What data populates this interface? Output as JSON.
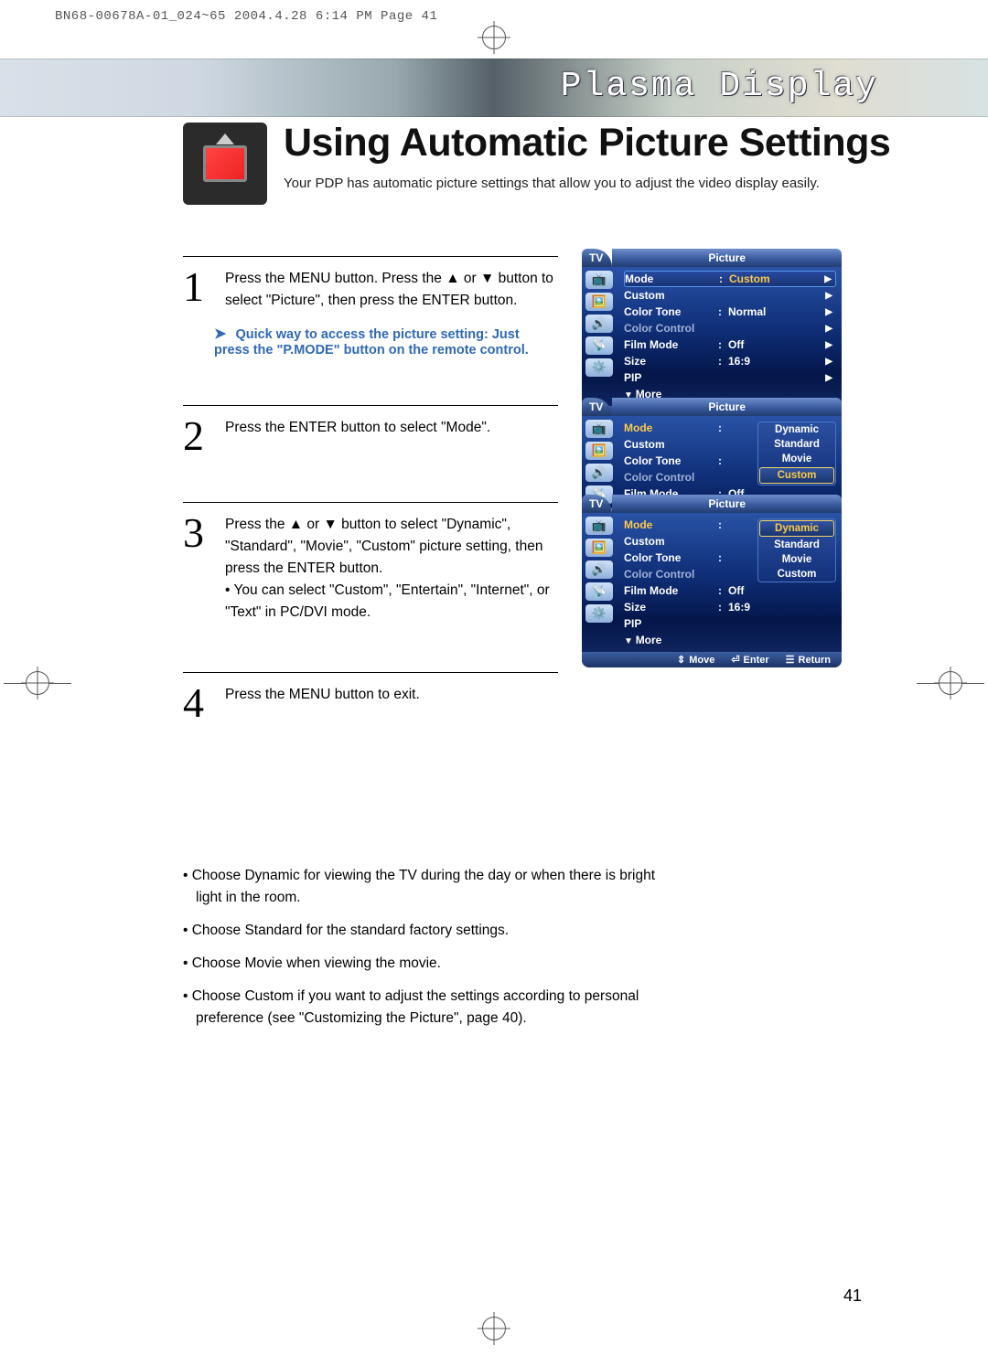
{
  "header_line": "BN68-00678A-01_024~65  2004.4.28  6:14 PM  Page 41",
  "banner_title": "Plasma Display",
  "page_title": "Using Automatic Picture Settings",
  "page_sub": "Your PDP has automatic picture settings that allow you to adjust the video display easily.",
  "steps": {
    "s1": {
      "num": "1",
      "text": "Press the MENU button. Press the ▲ or ▼ button to select \"Picture\", then press the ENTER button.",
      "tip": "Quick way to access the picture setting: Just press the \"P.MODE\" button on the remote control."
    },
    "s2": {
      "num": "2",
      "text": "Press the ENTER button to select \"Mode\"."
    },
    "s3": {
      "num": "3",
      "text_l1": "Press the ▲ or ▼ button to select \"Dynamic\", \"Standard\", \"Movie\", \"Custom\" picture setting, then press the ENTER button.",
      "text_l2": "• You can select \"Custom\", \"Entertain\", \"Internet\", or \"Text\" in PC/DVI mode."
    },
    "s4": {
      "num": "4",
      "text": "Press the MENU button to exit."
    }
  },
  "osd": {
    "tab": "TV",
    "title": "Picture",
    "rows": {
      "mode": {
        "k": "Mode",
        "v": "Custom"
      },
      "custom": {
        "k": "Custom",
        "v": ""
      },
      "colortone": {
        "k": "Color Tone",
        "v": "Normal"
      },
      "colorcontrol": {
        "k": "Color Control",
        "v": ""
      },
      "filmmode": {
        "k": "Film Mode",
        "v": "Off"
      },
      "size": {
        "k": "Size",
        "v": "16:9"
      },
      "pip": {
        "k": "PIP",
        "v": ""
      },
      "more": {
        "k": "More"
      }
    },
    "foot": {
      "move": "Move",
      "enter": "Enter",
      "return": "Return"
    },
    "popup": {
      "o1": "Dynamic",
      "o2": "Standard",
      "o3": "Movie",
      "o4": "Custom"
    }
  },
  "notes": {
    "n1": "Choose Dynamic for viewing the TV during the day or when there is bright light in the room.",
    "n2": "Choose Standard for the standard factory settings.",
    "n3": "Choose Movie when viewing the movie.",
    "n4": "Choose Custom if you want to adjust the settings according to personal preference (see \"Customizing the Picture\", page 40)."
  },
  "page_num": "41"
}
